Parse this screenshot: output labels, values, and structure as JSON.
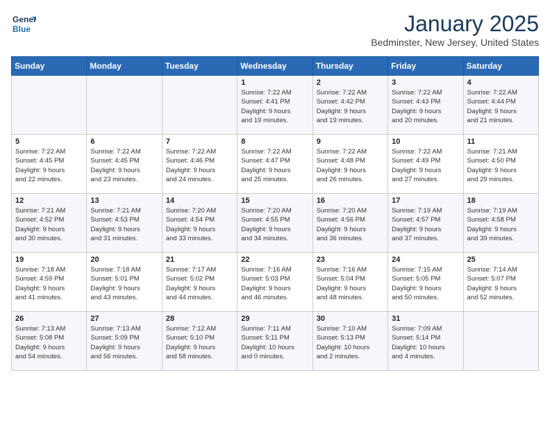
{
  "header": {
    "logo_line1": "General",
    "logo_line2": "Blue",
    "month": "January 2025",
    "location": "Bedminster, New Jersey, United States"
  },
  "weekdays": [
    "Sunday",
    "Monday",
    "Tuesday",
    "Wednesday",
    "Thursday",
    "Friday",
    "Saturday"
  ],
  "weeks": [
    [
      {
        "day": "",
        "info": ""
      },
      {
        "day": "",
        "info": ""
      },
      {
        "day": "",
        "info": ""
      },
      {
        "day": "1",
        "info": "Sunrise: 7:22 AM\nSunset: 4:41 PM\nDaylight: 9 hours\nand 19 minutes."
      },
      {
        "day": "2",
        "info": "Sunrise: 7:22 AM\nSunset: 4:42 PM\nDaylight: 9 hours\nand 19 minutes."
      },
      {
        "day": "3",
        "info": "Sunrise: 7:22 AM\nSunset: 4:43 PM\nDaylight: 9 hours\nand 20 minutes."
      },
      {
        "day": "4",
        "info": "Sunrise: 7:22 AM\nSunset: 4:44 PM\nDaylight: 9 hours\nand 21 minutes."
      }
    ],
    [
      {
        "day": "5",
        "info": "Sunrise: 7:22 AM\nSunset: 4:45 PM\nDaylight: 9 hours\nand 22 minutes."
      },
      {
        "day": "6",
        "info": "Sunrise: 7:22 AM\nSunset: 4:45 PM\nDaylight: 9 hours\nand 23 minutes."
      },
      {
        "day": "7",
        "info": "Sunrise: 7:22 AM\nSunset: 4:46 PM\nDaylight: 9 hours\nand 24 minutes."
      },
      {
        "day": "8",
        "info": "Sunrise: 7:22 AM\nSunset: 4:47 PM\nDaylight: 9 hours\nand 25 minutes."
      },
      {
        "day": "9",
        "info": "Sunrise: 7:22 AM\nSunset: 4:48 PM\nDaylight: 9 hours\nand 26 minutes."
      },
      {
        "day": "10",
        "info": "Sunrise: 7:22 AM\nSunset: 4:49 PM\nDaylight: 9 hours\nand 27 minutes."
      },
      {
        "day": "11",
        "info": "Sunrise: 7:21 AM\nSunset: 4:50 PM\nDaylight: 9 hours\nand 29 minutes."
      }
    ],
    [
      {
        "day": "12",
        "info": "Sunrise: 7:21 AM\nSunset: 4:52 PM\nDaylight: 9 hours\nand 30 minutes."
      },
      {
        "day": "13",
        "info": "Sunrise: 7:21 AM\nSunset: 4:53 PM\nDaylight: 9 hours\nand 31 minutes."
      },
      {
        "day": "14",
        "info": "Sunrise: 7:20 AM\nSunset: 4:54 PM\nDaylight: 9 hours\nand 33 minutes."
      },
      {
        "day": "15",
        "info": "Sunrise: 7:20 AM\nSunset: 4:55 PM\nDaylight: 9 hours\nand 34 minutes."
      },
      {
        "day": "16",
        "info": "Sunrise: 7:20 AM\nSunset: 4:56 PM\nDaylight: 9 hours\nand 36 minutes."
      },
      {
        "day": "17",
        "info": "Sunrise: 7:19 AM\nSunset: 4:57 PM\nDaylight: 9 hours\nand 37 minutes."
      },
      {
        "day": "18",
        "info": "Sunrise: 7:19 AM\nSunset: 4:58 PM\nDaylight: 9 hours\nand 39 minutes."
      }
    ],
    [
      {
        "day": "19",
        "info": "Sunrise: 7:18 AM\nSunset: 4:59 PM\nDaylight: 9 hours\nand 41 minutes."
      },
      {
        "day": "20",
        "info": "Sunrise: 7:18 AM\nSunset: 5:01 PM\nDaylight: 9 hours\nand 43 minutes."
      },
      {
        "day": "21",
        "info": "Sunrise: 7:17 AM\nSunset: 5:02 PM\nDaylight: 9 hours\nand 44 minutes."
      },
      {
        "day": "22",
        "info": "Sunrise: 7:16 AM\nSunset: 5:03 PM\nDaylight: 9 hours\nand 46 minutes."
      },
      {
        "day": "23",
        "info": "Sunrise: 7:16 AM\nSunset: 5:04 PM\nDaylight: 9 hours\nand 48 minutes."
      },
      {
        "day": "24",
        "info": "Sunrise: 7:15 AM\nSunset: 5:05 PM\nDaylight: 9 hours\nand 50 minutes."
      },
      {
        "day": "25",
        "info": "Sunrise: 7:14 AM\nSunset: 5:07 PM\nDaylight: 9 hours\nand 52 minutes."
      }
    ],
    [
      {
        "day": "26",
        "info": "Sunrise: 7:13 AM\nSunset: 5:08 PM\nDaylight: 9 hours\nand 54 minutes."
      },
      {
        "day": "27",
        "info": "Sunrise: 7:13 AM\nSunset: 5:09 PM\nDaylight: 9 hours\nand 56 minutes."
      },
      {
        "day": "28",
        "info": "Sunrise: 7:12 AM\nSunset: 5:10 PM\nDaylight: 9 hours\nand 58 minutes."
      },
      {
        "day": "29",
        "info": "Sunrise: 7:11 AM\nSunset: 5:11 PM\nDaylight: 10 hours\nand 0 minutes."
      },
      {
        "day": "30",
        "info": "Sunrise: 7:10 AM\nSunset: 5:13 PM\nDaylight: 10 hours\nand 2 minutes."
      },
      {
        "day": "31",
        "info": "Sunrise: 7:09 AM\nSunset: 5:14 PM\nDaylight: 10 hours\nand 4 minutes."
      },
      {
        "day": "",
        "info": ""
      }
    ]
  ]
}
